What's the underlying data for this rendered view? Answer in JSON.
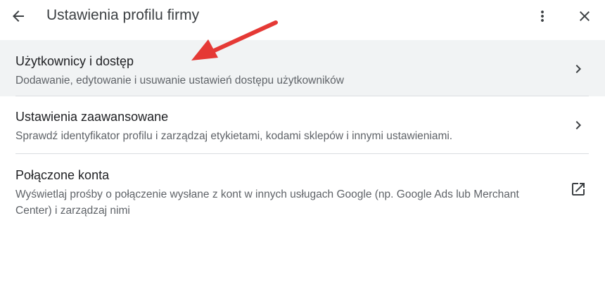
{
  "header": {
    "title": "Ustawienia profilu firmy",
    "back_icon": "arrow-back-icon",
    "more_icon": "more-vert-icon",
    "close_icon": "close-icon"
  },
  "items": [
    {
      "label": "Użytkownicy i dostęp",
      "description": "Dodawanie, edytowanie i usuwanie ustawień dostępu użytkowników",
      "trailing_icon": "chevron-right-icon",
      "highlighted": true
    },
    {
      "label": "Ustawienia zaawansowane",
      "description": "Sprawdź identyfikator profilu i zarządzaj etykietami, kodami sklepów i innymi ustawieniami.",
      "trailing_icon": "chevron-right-icon",
      "highlighted": false
    },
    {
      "label": "Połączone konta",
      "description": "Wyświetlaj prośby o połączenie wysłane z kont w innych usługach Google (np. Google Ads lub Merchant Center) i zarządzaj nimi",
      "trailing_icon": "open-in-new-icon",
      "highlighted": false
    }
  ],
  "colors": {
    "highlight_background": "#f1f3f4",
    "annotation_arrow": "#e53935",
    "icon": "#3c4043"
  }
}
